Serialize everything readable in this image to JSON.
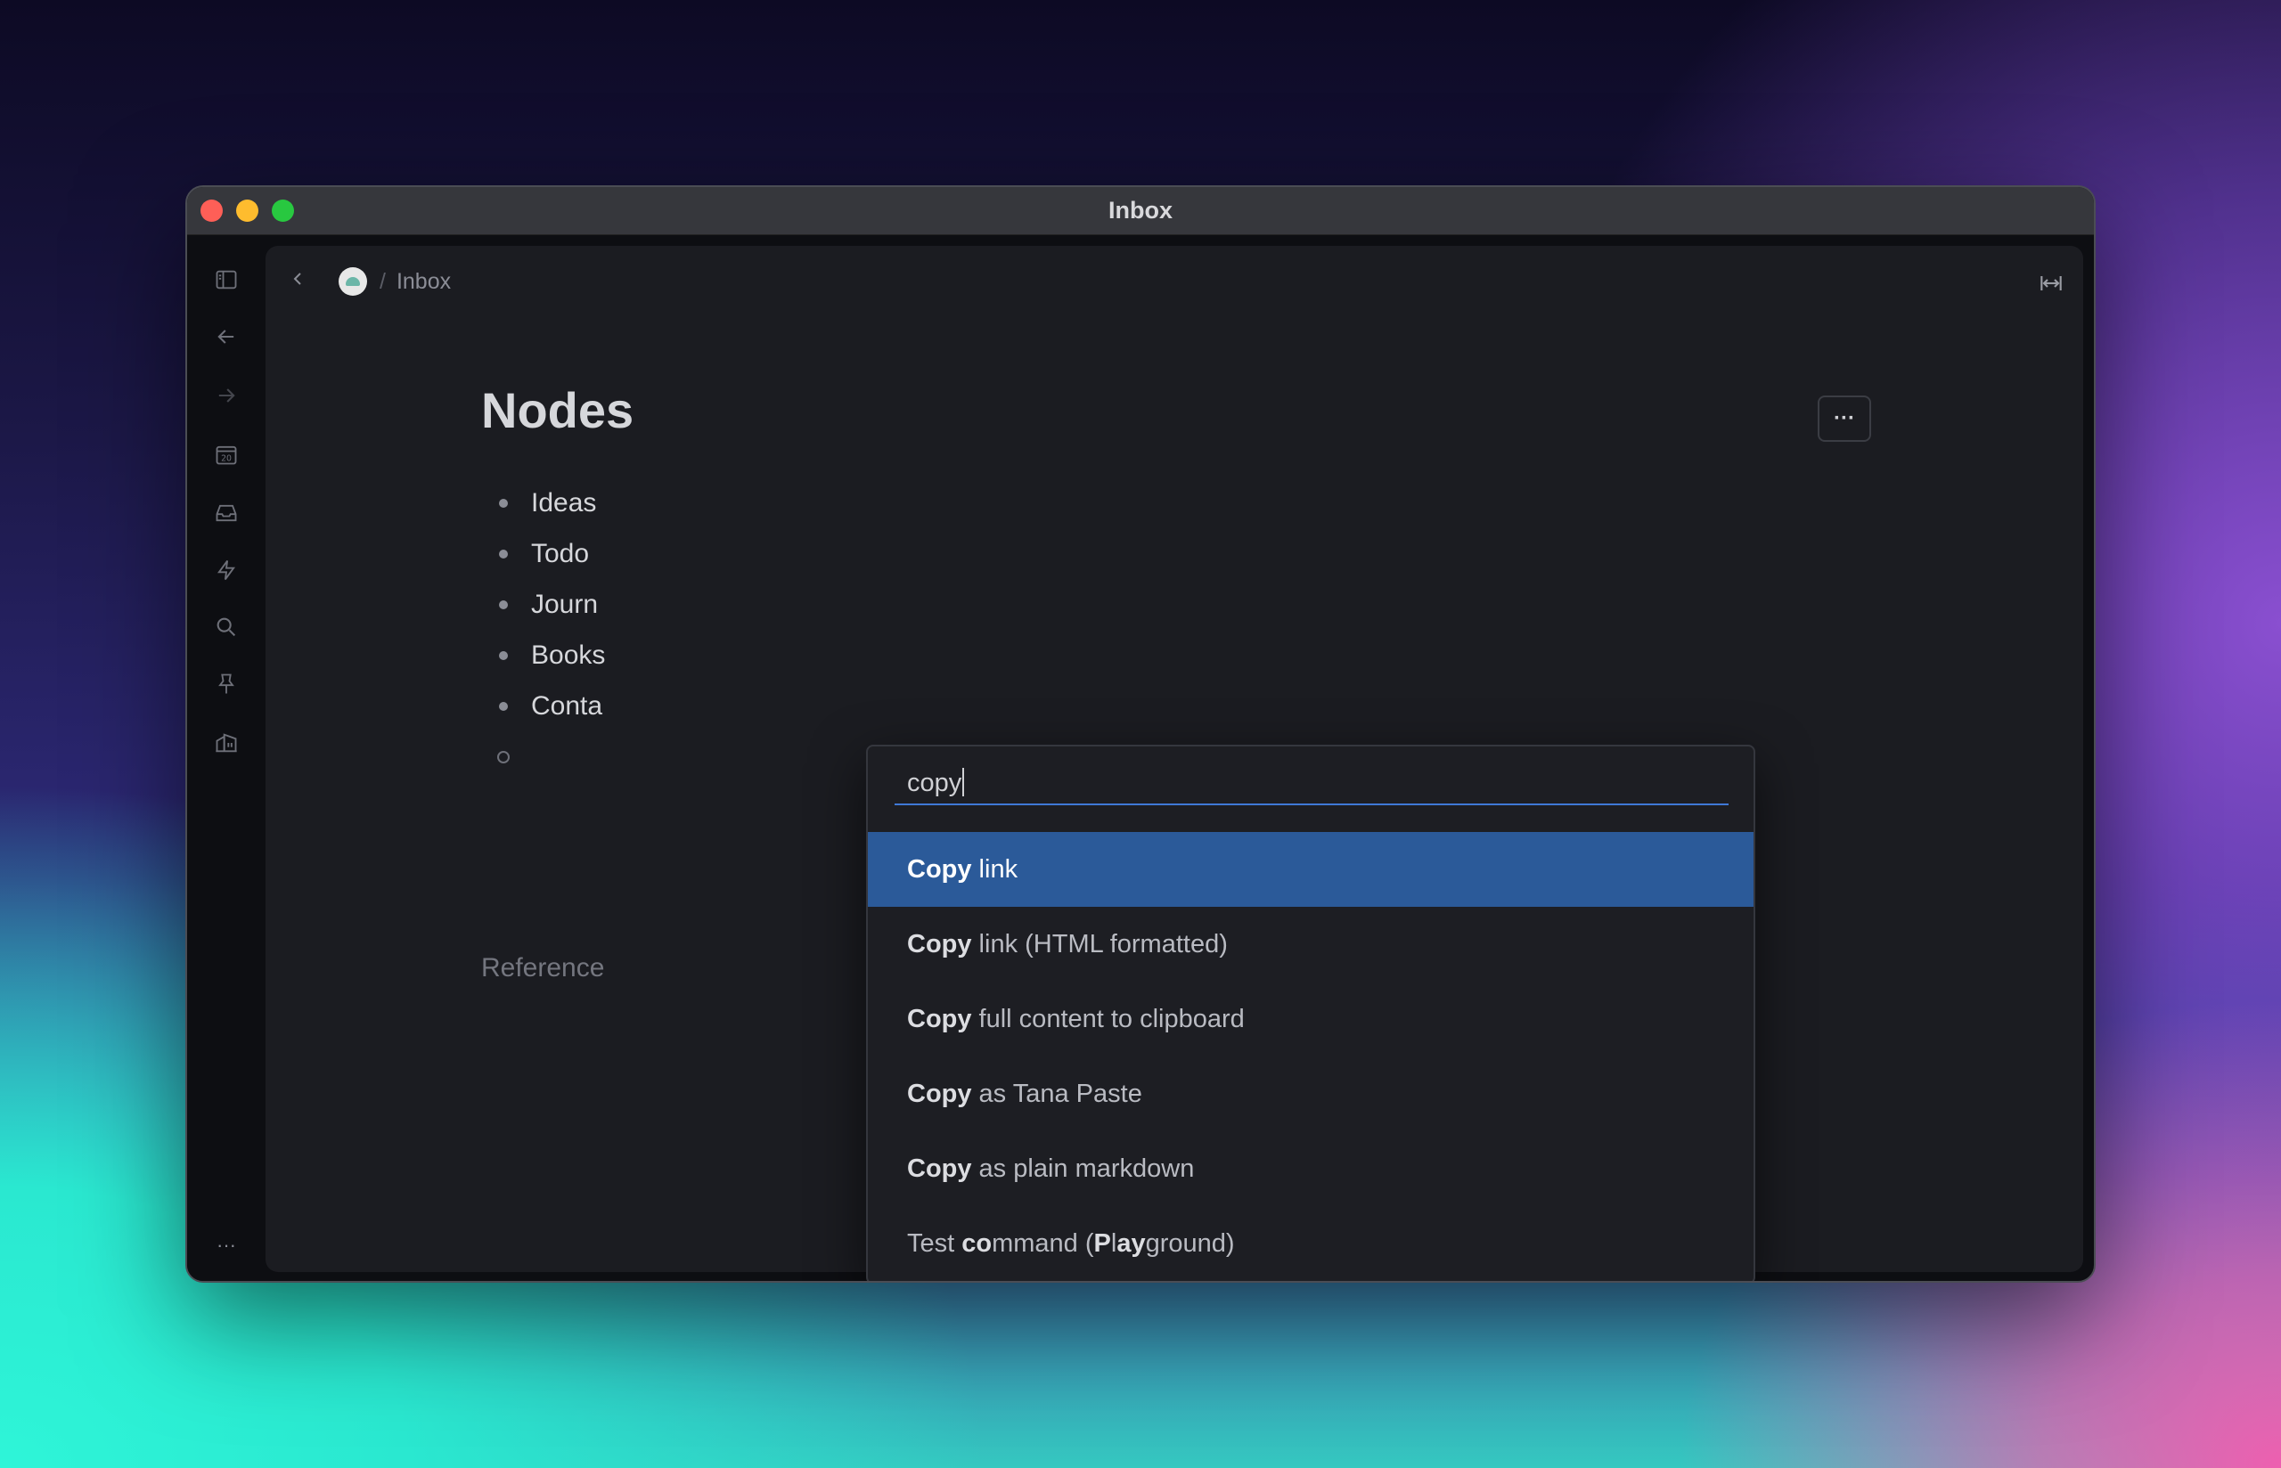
{
  "window": {
    "title": "Inbox"
  },
  "rail": {
    "icons": [
      "sidebar-toggle-icon",
      "back-arrow-icon",
      "forward-arrow-icon",
      "calendar-icon",
      "inbox-icon",
      "lightning-icon",
      "search-icon",
      "pin-icon",
      "workspace-home-icon",
      "more-icon"
    ],
    "calendar_day": "20",
    "more_label": "···"
  },
  "breadcrumb": {
    "separator": "/",
    "current": "Inbox"
  },
  "page": {
    "title": "Nodes",
    "more_label": "···"
  },
  "nodes": [
    "Ideas",
    "Todo",
    "Journ",
    "Books",
    "Conta"
  ],
  "references_label": "Reference",
  "palette": {
    "query": "copy",
    "options": [
      {
        "bold": "Copy",
        "rest": " link"
      },
      {
        "bold": "Copy",
        "rest": " link (HTML formatted)"
      },
      {
        "bold": "Copy",
        "rest": " full content to clipboard"
      },
      {
        "bold": "Copy",
        "rest": " as Tana Paste"
      },
      {
        "bold": "Copy",
        "rest": " as plain markdown"
      },
      {
        "pre": "Test ",
        "b1": "co",
        "mid": "mmand (",
        "b2": "P",
        "rest": "l",
        "b3": "ay",
        "end": "ground)"
      }
    ]
  },
  "colors": {
    "accent": "#2b5a99",
    "focus_line": "#3f78d6"
  }
}
